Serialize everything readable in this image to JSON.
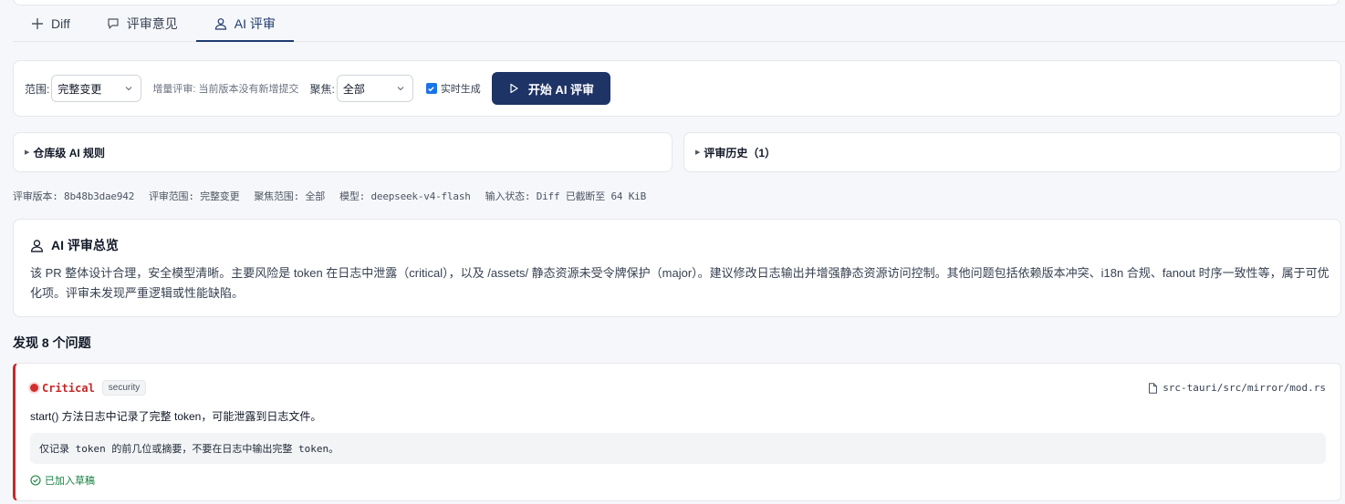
{
  "tabs": [
    {
      "label": "Diff",
      "icon": "plus-icon"
    },
    {
      "label": "评审意见",
      "icon": "comment-icon"
    },
    {
      "label": "AI 评审",
      "icon": "user-icon",
      "active": true
    }
  ],
  "toolbar": {
    "scope_label": "范围:",
    "scope_value": "完整变更",
    "incremental_hint": "增量评审: 当前版本没有新增提交",
    "focus_label": "聚焦:",
    "focus_value": "全部",
    "realtime_label": "实时生成",
    "realtime_checked": true,
    "start_button": "开始 AI 评审"
  },
  "panels": {
    "repo_rules": "仓库级 AI 规则",
    "history": "评审历史（1）"
  },
  "meta": {
    "version": "评审版本: 8b48b3dae942",
    "scope": "评审范围: 完整变更",
    "focus": "聚焦范围: 全部",
    "model": "模型: deepseek-v4-flash",
    "input_status": "输入状态: Diff 已截断至 64 KiB"
  },
  "summary": {
    "title": "AI 评审总览",
    "body": "该 PR 整体设计合理，安全模型清晰。主要风险是 token 在日志中泄露（critical），以及 /assets/ 静态资源未受令牌保护（major）。建议修改日志输出并增强静态资源访问控制。其他问题包括依赖版本冲突、i18n 合规、fanout 时序一致性等，属于可优化项。评审未发现严重逻辑或性能缺陷。"
  },
  "found_title": "发现 8 个问题",
  "issues": [
    {
      "severity": "Critical",
      "category": "security",
      "file": "src-tauri/src/mirror/mod.rs",
      "description": "start() 方法日志中记录了完整 token，可能泄露到日志文件。",
      "suggestion": "仅记录 token 的前几位或摘要，不要在日志中输出完整 token。",
      "status": "已加入草稿"
    }
  ],
  "colors": {
    "primary": "#1e3366",
    "critical": "#c62828",
    "success": "#15803d"
  }
}
